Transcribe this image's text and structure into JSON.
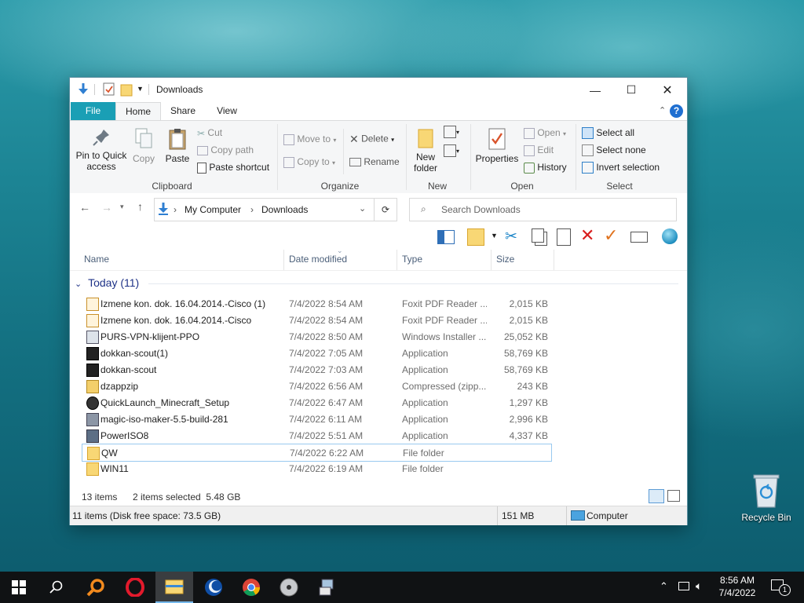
{
  "window": {
    "title": "Downloads",
    "minimize_glyph": "—",
    "maximize_glyph": "☐",
    "close_glyph": "✕"
  },
  "ribbon_tabs": [
    "File",
    "Home",
    "Share",
    "View"
  ],
  "ribbon": {
    "clipboard": {
      "label": "Clipboard",
      "pin": "Pin to Quick access",
      "pin_line1": "Pin to Quick",
      "pin_line2": "access",
      "copy": "Copy",
      "paste": "Paste",
      "cut": "Cut",
      "copy_path": "Copy path",
      "paste_shortcut": "Paste shortcut"
    },
    "organize": {
      "label": "Organize",
      "move_to": "Move to",
      "copy_to": "Copy to",
      "delete": "Delete",
      "rename": "Rename"
    },
    "new": {
      "label": "New",
      "new_folder_line1": "New",
      "new_folder_line2": "folder"
    },
    "open": {
      "label": "Open",
      "properties": "Properties",
      "open": "Open",
      "edit": "Edit",
      "history": "History"
    },
    "select": {
      "label": "Select",
      "select_all": "Select all",
      "select_none": "Select none",
      "invert": "Invert selection"
    }
  },
  "address": {
    "crumbs": [
      "My Computer",
      "Downloads"
    ],
    "search_placeholder": "Search Downloads"
  },
  "columns": {
    "name": "Name",
    "date": "Date modified",
    "type": "Type",
    "size": "Size"
  },
  "group": "Today (11)",
  "files": [
    {
      "name": "Izmene kon. dok. 16.04.2014.-Cisco (1)",
      "date": "7/4/2022 8:54 AM",
      "type": "Foxit PDF Reader ...",
      "size": "2,015 KB",
      "icon": "pdf-icon"
    },
    {
      "name": "Izmene kon. dok. 16.04.2014.-Cisco",
      "date": "7/4/2022 8:54 AM",
      "type": "Foxit PDF Reader ...",
      "size": "2,015 KB",
      "icon": "pdf-icon"
    },
    {
      "name": "PURS-VPN-klijent-PPO",
      "date": "7/4/2022 8:50 AM",
      "type": "Windows Installer ...",
      "size": "25,052 KB",
      "icon": "installer-icon"
    },
    {
      "name": "dokkan-scout(1)",
      "date": "7/4/2022 7:05 AM",
      "type": "Application",
      "size": "58,769 KB",
      "icon": "app-icon"
    },
    {
      "name": "dokkan-scout",
      "date": "7/4/2022 7:03 AM",
      "type": "Application",
      "size": "58,769 KB",
      "icon": "app-icon"
    },
    {
      "name": "dzappzip",
      "date": "7/4/2022 6:56 AM",
      "type": "Compressed (zipp...",
      "size": "243 KB",
      "icon": "zip-icon"
    },
    {
      "name": "QuickLaunch_Minecraft_Setup",
      "date": "7/4/2022 6:47 AM",
      "type": "Application",
      "size": "1,297 KB",
      "icon": "app-icon"
    },
    {
      "name": "magic-iso-maker-5.5-build-281",
      "date": "7/4/2022 6:11 AM",
      "type": "Application",
      "size": "2,996 KB",
      "icon": "app-icon"
    },
    {
      "name": "PowerISO8",
      "date": "7/4/2022 5:51 AM",
      "type": "Application",
      "size": "4,337 KB",
      "icon": "app-icon"
    },
    {
      "name": "QW",
      "date": "7/4/2022 6:22 AM",
      "type": "File folder",
      "size": "",
      "icon": "folder-icon",
      "selected": true
    },
    {
      "name": "WIN11",
      "date": "7/4/2022 6:19 AM",
      "type": "File folder",
      "size": "",
      "icon": "folder-icon"
    }
  ],
  "status": {
    "items": "13 items",
    "selected": "2 items selected  5.48 GB",
    "disk": "11 items (Disk free space: 73.5 GB)",
    "mb": "151 MB",
    "computer": "Computer"
  },
  "desktop": {
    "recycle_bin": "Recycle Bin"
  },
  "taskbar": {
    "time": "8:56 AM",
    "date": "7/4/2022",
    "notif_count": "1"
  },
  "colors": {
    "file_tab": "#1a9fb5",
    "selection_border": "#99c9ef",
    "group_header": "#1e3287"
  }
}
